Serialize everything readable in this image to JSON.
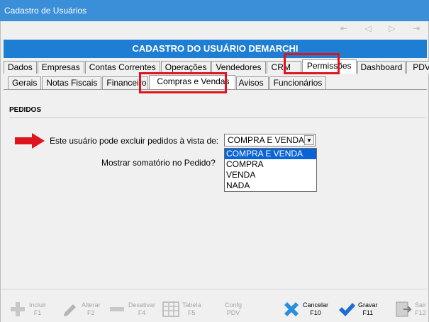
{
  "window": {
    "title": "Cadastro de Usuários"
  },
  "nav": {
    "first": "⇤",
    "prev": "◁",
    "next": "▷",
    "last": "⇥"
  },
  "header": {
    "title": "CADASTRO DO USUÁRIO DEMARCHI"
  },
  "tabs_main": [
    {
      "label": "Dados"
    },
    {
      "label": "Empresas"
    },
    {
      "label": "Contas Correntes"
    },
    {
      "label": "Operações"
    },
    {
      "label": "Vendedores"
    },
    {
      "label": "CRM"
    },
    {
      "label": "Permissões"
    },
    {
      "label": "Dashboard"
    },
    {
      "label": "PDV"
    }
  ],
  "tabs_sub": [
    {
      "label": "Gerais"
    },
    {
      "label": "Notas Fiscais"
    },
    {
      "label": "Financeiro"
    },
    {
      "label": "Compras e Vendas"
    },
    {
      "label": "Avisos"
    },
    {
      "label": "Funcionários"
    }
  ],
  "section": {
    "title": "PEDIDOS"
  },
  "fields": {
    "excluir_label": "Este usuário pode excluir pedidos à vista de:",
    "excluir_value": "COMPRA E VENDA",
    "somatorio_label": "Mostrar somatório no Pedido?"
  },
  "dropdown": {
    "options": [
      "COMPRA E VENDA",
      "COMPRA",
      "VENDA",
      "NADA"
    ]
  },
  "footer": {
    "incluir": {
      "label": "Incluir",
      "key": "F1"
    },
    "alterar": {
      "label": "Alterar",
      "key": "F2"
    },
    "desativar": {
      "label": "Desativar",
      "key": "F4"
    },
    "tabela": {
      "label": "Tabela",
      "key": "F5"
    },
    "confg": {
      "label": "Confg",
      "key": "PDV"
    },
    "cancelar": {
      "label": "Cancelar",
      "key": "F10"
    },
    "gravar": {
      "label": "Gravar",
      "key": "F11"
    },
    "sair": {
      "label": "Sair",
      "key": "F12"
    }
  },
  "colors": {
    "titlebar": "#3a8fd8",
    "header": "#1e7ed3",
    "highlight": "#e0141f",
    "selected": "#0a64d6"
  }
}
